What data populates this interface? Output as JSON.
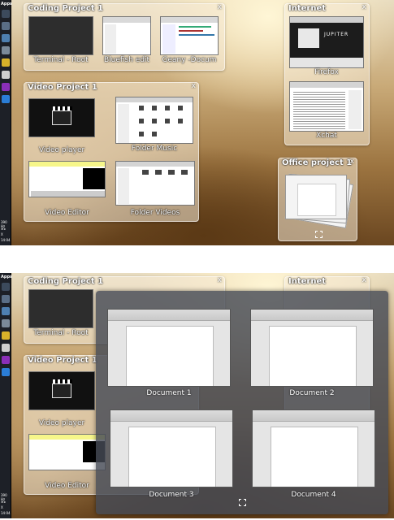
{
  "sidebar": {
    "apps_label": "Apps",
    "freq": "390 Hz",
    "x_label": "X",
    "clock": "14:04"
  },
  "panels": {
    "coding": {
      "title": "Coding Project 1",
      "close": "x",
      "thumbs": [
        "Terminal - Root",
        "Bluefish edit",
        "Geany -Docum"
      ]
    },
    "internet": {
      "title": "Internet",
      "close": "x",
      "thumbs": [
        "Firefox",
        "Xchat"
      ],
      "firefox_page_text": "JUPITER"
    },
    "video": {
      "title": "Video Project 1",
      "close": "x",
      "thumbs": [
        "Video player",
        "Folder Music",
        "Video Editor",
        "Folder Videos"
      ]
    },
    "office": {
      "title": "Office project 1",
      "close": "x"
    }
  },
  "expanded_office": {
    "documents": [
      "Document 1",
      "Document 2",
      "Document 3",
      "Document 4"
    ]
  },
  "colors": {
    "sidebar_bg": "#1d2027",
    "overlay_bg": "#464b55",
    "label_text": "#ffffff"
  }
}
